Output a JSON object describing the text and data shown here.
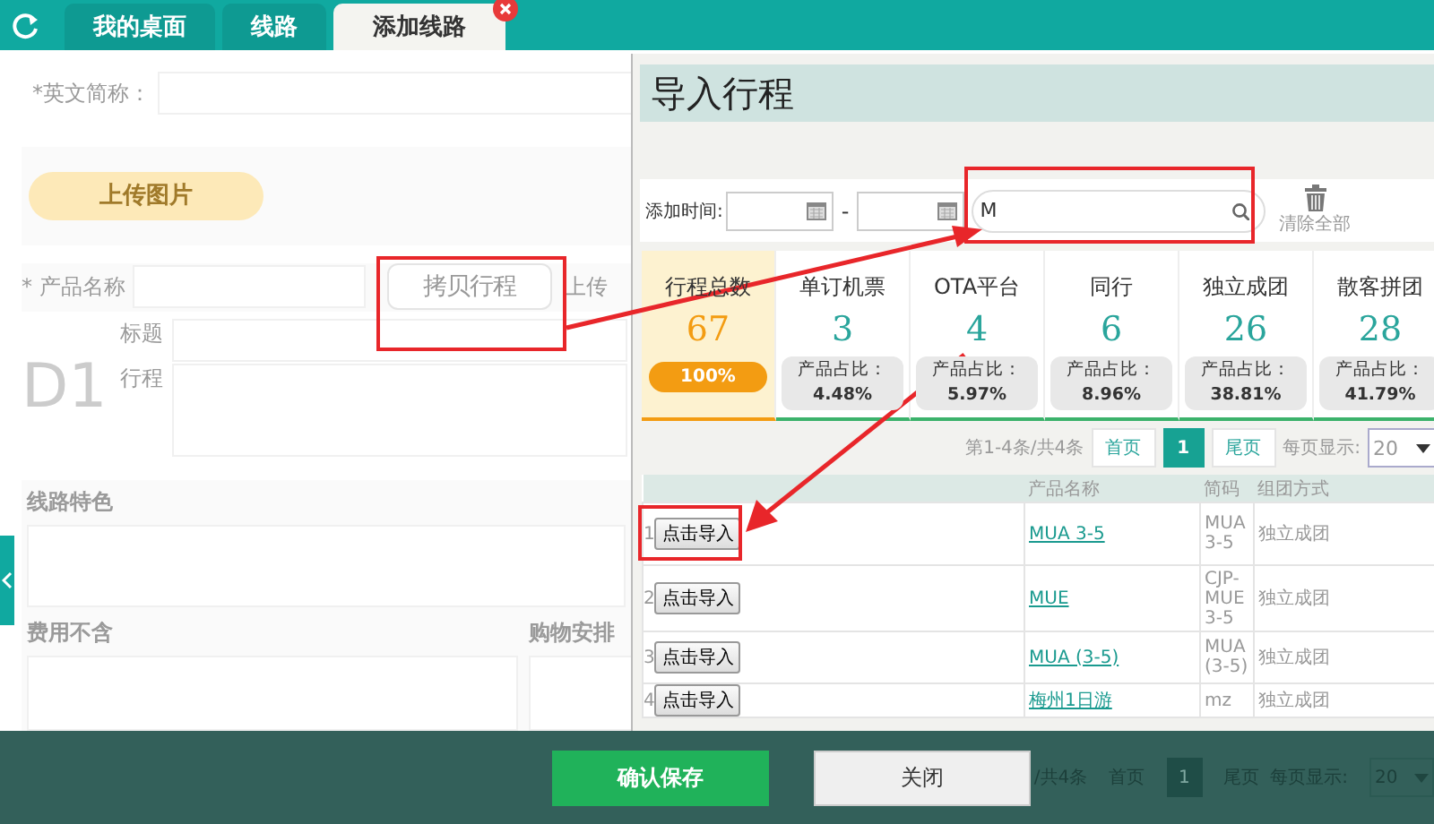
{
  "tabs": [
    {
      "label": "我的桌面",
      "selected": false,
      "closable": false
    },
    {
      "label": "线路",
      "selected": false,
      "closable": false
    },
    {
      "label": "添加线路",
      "selected": true,
      "closable": true
    }
  ],
  "form": {
    "english_abbr_label": "*英文简称：",
    "upload_button": "上传图片",
    "product_name_label": "* 产品名称",
    "copy_button": "拷贝行程",
    "upload_label": "上传",
    "day_label": "D1",
    "title_label": "标题",
    "itinerary_label": "行程",
    "features_label": "线路特色",
    "excluded_label": "费用不含",
    "shopping_label": "购物安排"
  },
  "dialog": {
    "title": "导入行程",
    "date_label": "添加时间:",
    "date_separator": "-",
    "search_value": "M",
    "clear_label": "清除全部",
    "stats": [
      {
        "kind": "total",
        "label": "行程总数",
        "value": "67",
        "share": "100%",
        "selected": true
      },
      {
        "kind": "ratio",
        "label": "单订机票",
        "value": "3",
        "share": "产品占比：**4.48%**",
        "selected": false
      },
      {
        "kind": "ratio",
        "label": "OTA平台",
        "value": "4",
        "share": "产品占比：**5.97%**",
        "selected": false
      },
      {
        "kind": "ratio",
        "label": "同行",
        "value": "6",
        "share": "产品占比：**8.96%**",
        "selected": false
      },
      {
        "kind": "ratio",
        "label": "独立成团",
        "value": "26",
        "share": "产品占比：**38.81%**",
        "selected": false
      },
      {
        "kind": "ratio",
        "label": "散客拼团",
        "value": "28",
        "share": "产品占比：**41.79%**",
        "selected": false
      }
    ],
    "pagination": {
      "summary": "第1-4条/共4条",
      "first": "首页",
      "pages": [
        {
          "label": "1",
          "selected": true
        }
      ],
      "last": "尾页",
      "page_size_label": "每页显示:",
      "page_size": "20"
    },
    "table": {
      "columns": [
        "产品名称",
        "简码",
        "组团方式"
      ],
      "rows": [
        {
          "index": "1",
          "action": "点击导入",
          "name": "MUA 3-5",
          "code": "MUA 3-5",
          "mode": "独立成团"
        },
        {
          "index": "2",
          "action": "点击导入",
          "name": "MUE",
          "code": "CJP-MUE 3-5",
          "mode": "独立成团"
        },
        {
          "index": "3",
          "action": "点击导入",
          "name": "MUA (3-5)",
          "code": "MUA (3-5)",
          "mode": "独立成团"
        },
        {
          "index": "4",
          "action": "点击导入",
          "name": "梅州1日游",
          "code": "mz",
          "mode": "独立成团"
        }
      ]
    },
    "footer_pagination": {
      "summary": "/共4条",
      "first": "首页",
      "page": "1",
      "last": "尾页",
      "page_size_label": "每页显示:",
      "page_size": "20"
    }
  },
  "footer": {
    "buttons": [
      {
        "label": "确认保存",
        "kind": "primary"
      },
      {
        "label": "关闭",
        "kind": "secondary"
      }
    ]
  }
}
